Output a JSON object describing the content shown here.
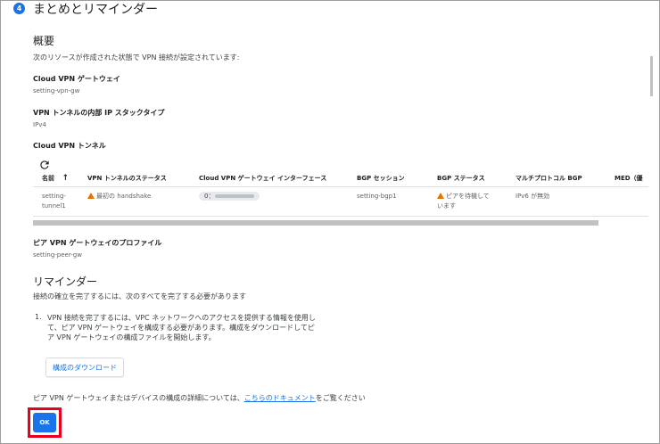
{
  "step": {
    "number": "4",
    "title": "まとめとリマインダー"
  },
  "overview": {
    "heading": "概要",
    "intro": "次のリソースが作成された状態で VPN 接続が設定されています:",
    "gateway_label": "Cloud VPN ゲートウェイ",
    "gateway_value": "setting-vpn-gw",
    "ip_stack_label": "VPN トンネルの内部 IP スタックタイプ",
    "ip_stack_value": "IPv4",
    "tunnel_label": "Cloud VPN トンネル"
  },
  "table": {
    "refresh_icon": "refresh-icon",
    "columns": {
      "name": "名前",
      "tunnel_status": "VPN トンネルのステータス",
      "interface": "Cloud VPN ゲートウェイ インターフェース",
      "bgp_session": "BGP セッション",
      "bgp_status": "BGP ステータス",
      "multiprotocol": "マルチプロトコル BGP",
      "med": "MED（優"
    },
    "row": {
      "name_line1": "setting-",
      "name_line2": "tunnel1",
      "tunnel_status": "最初の handshake",
      "interface_prefix": "0：",
      "bgp_session": "setting-bgp1",
      "bgp_status_line1": "ピアを待機して",
      "bgp_status_line2": "います",
      "multiprotocol": "IPv6 が無効"
    }
  },
  "peer": {
    "label": "ピア VPN ゲートウェイのプロファイル",
    "value": "setting-peer-gw"
  },
  "reminder": {
    "heading": "リマインダー",
    "intro": "接続の確立を完了するには、次のすべてを完了する必要があります",
    "item_number": "1.",
    "item_line1": "VPN 接続を完了するには、VPC ネットワークへのアクセスを提供する情報を使用し",
    "item_line2": "て、ピア VPN ゲートウェイを構成する必要があります。構成をダウンロードしてピ",
    "item_line3": "ア VPN ゲートウェイの構成ファイルを開始します。",
    "download_button": "構成のダウンロード",
    "footer_prefix": "ピア VPN ゲートウェイまたはデバイスの構成の詳細については、",
    "footer_link": "こちらのドキュメント",
    "footer_suffix": "をご覧ください"
  },
  "ok_button": "OK",
  "colors": {
    "accent": "#1a73e8",
    "warning": "#e37400",
    "highlight": "#e8001c"
  }
}
